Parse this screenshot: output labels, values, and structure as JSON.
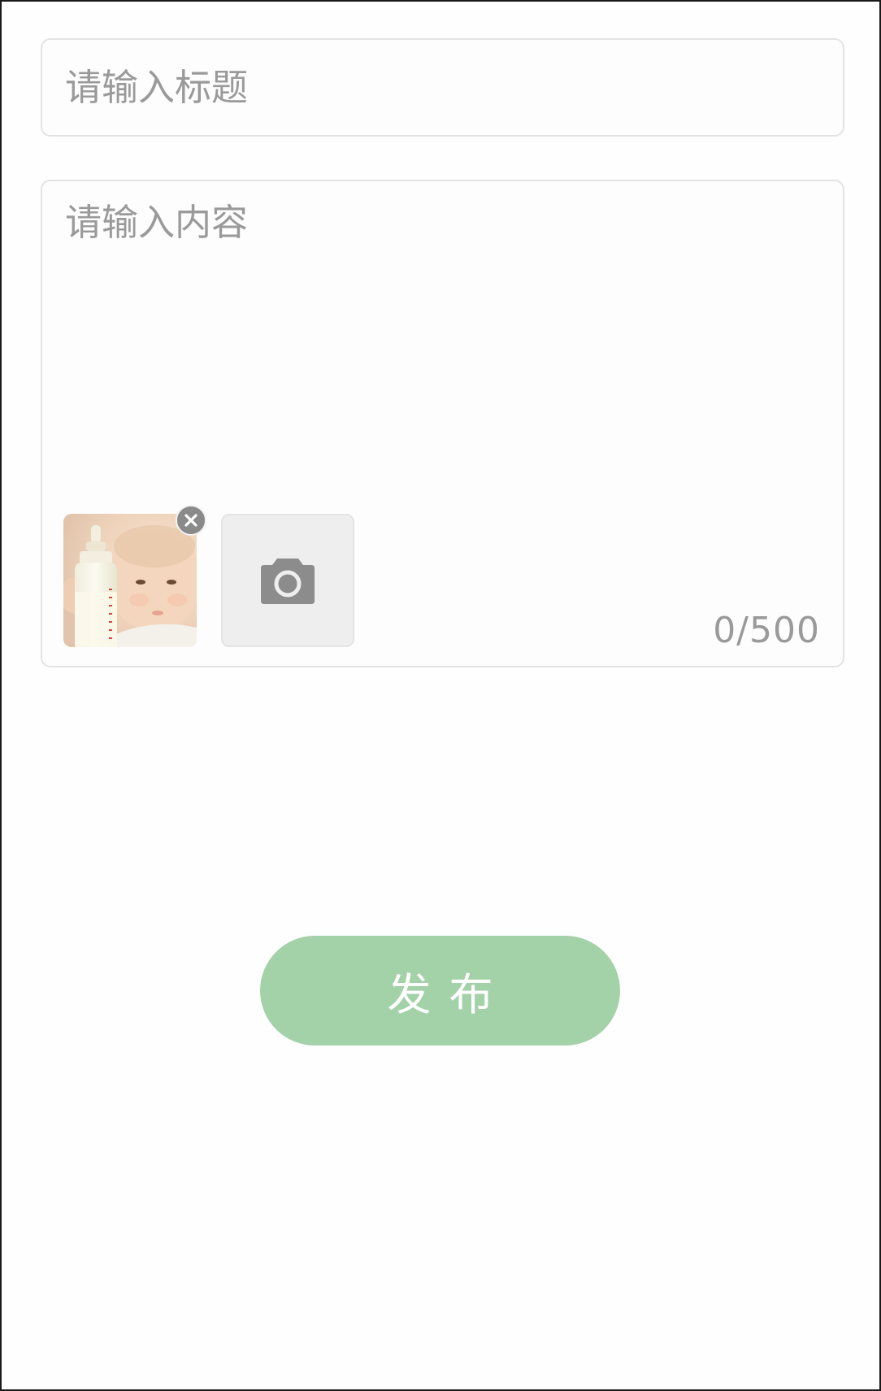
{
  "form": {
    "title_placeholder": "请输入标题",
    "title_value": "",
    "content_placeholder": "请输入内容",
    "content_value": "",
    "char_counter": "0/500"
  },
  "attachments": [
    {
      "icon": "remove-icon",
      "image_subject": "baby-with-milk-bottle"
    }
  ],
  "add_photo_icon": "camera-icon",
  "publish_label": "发布",
  "colors": {
    "accent": "#a3d1a8",
    "border": "#e3e3e3",
    "placeholder": "#9a9a9a",
    "add_photo_bg": "#eeeeee"
  }
}
